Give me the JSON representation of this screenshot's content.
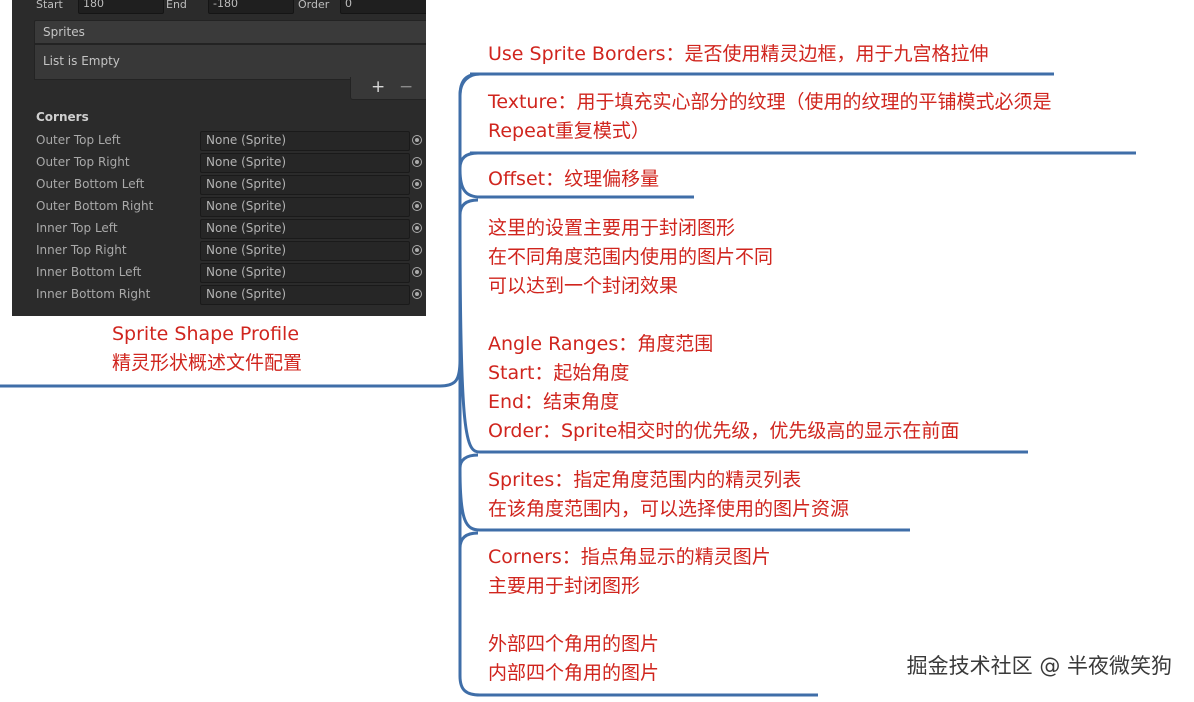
{
  "inspector": {
    "top_row": {
      "start_label": "Start",
      "start_value": "180",
      "end_label": "End",
      "end_value": "-180",
      "order_label": "Order",
      "order_value": "0"
    },
    "sprites_header": "Sprites",
    "sprites_empty": "List is Empty",
    "plus": "+",
    "minus": "−",
    "corners_title": "Corners",
    "corners": [
      {
        "label": "Outer Top Left",
        "value": "None (Sprite)"
      },
      {
        "label": "Outer Top Right",
        "value": "None (Sprite)"
      },
      {
        "label": "Outer Bottom Left",
        "value": "None (Sprite)"
      },
      {
        "label": "Outer Bottom Right",
        "value": "None (Sprite)"
      },
      {
        "label": "Inner Top Left",
        "value": "None (Sprite)"
      },
      {
        "label": "Inner Top Right",
        "value": "None (Sprite)"
      },
      {
        "label": "Inner Bottom Left",
        "value": "None (Sprite)"
      },
      {
        "label": "Inner Bottom Right",
        "value": "None (Sprite)"
      }
    ]
  },
  "root": {
    "line1": "Sprite Shape Profile",
    "line2": "精灵形状概述文件配置"
  },
  "nodes": {
    "use_sprite_borders": "Use Sprite Borders：是否使用精灵边框，用于九宫格拉伸",
    "texture_line1": "Texture：用于填充实心部分的纹理（使用的纹理的平铺模式必须是",
    "texture_line2": "Repeat重复模式）",
    "offset": "Offset：纹理偏移量",
    "angle_line1": "这里的设置主要用于封闭图形",
    "angle_line2": "在不同角度范围内使用的图片不同",
    "angle_line3": "可以达到一个封闭效果",
    "angle_line4": "Angle Ranges：角度范围",
    "angle_line5": "Start：起始角度",
    "angle_line6": "End：结束角度",
    "angle_line7": "Order：Sprite相交时的优先级，优先级高的显示在前面",
    "sprites_line1": "Sprites：指定角度范围内的精灵列表",
    "sprites_line2": "在该角度范围内，可以选择使用的图片资源",
    "corners_line1": "Corners：指点角显示的精灵图片",
    "corners_line2": "主要用于封闭图形",
    "corners_line3": "外部四个角用的图片",
    "corners_line4": "内部四个角用的图片"
  },
  "watermark": "掘金技术社区 @ 半夜微笑狗",
  "colors": {
    "annotation_text": "#d0251e",
    "connector": "#3f6ea8",
    "inspector_bg": "#2b2b2b"
  }
}
